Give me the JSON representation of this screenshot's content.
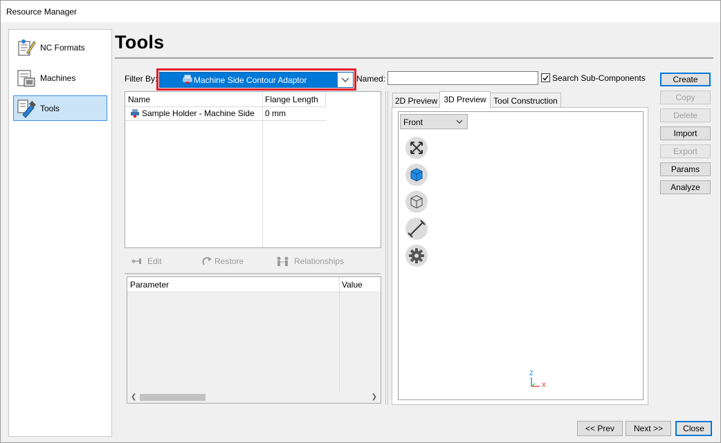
{
  "window": {
    "title": "Resource Manager"
  },
  "nav": {
    "items": [
      {
        "label": "NC Formats",
        "icon": "nc-formats-icon",
        "selected": false
      },
      {
        "label": "Machines",
        "icon": "machines-icon",
        "selected": false
      },
      {
        "label": "Tools",
        "icon": "tools-icon",
        "selected": true
      }
    ]
  },
  "page": {
    "title": "Tools"
  },
  "filter": {
    "label": "Filter By:",
    "selected": "Machine Side Contour Adaptor",
    "icon": "tool-holder-icon"
  },
  "named": {
    "label": "Named:",
    "value": ""
  },
  "search_sub": {
    "label": "Search Sub-Components",
    "checked": true
  },
  "tools_table": {
    "columns": [
      "Name",
      "Flange Length"
    ],
    "rows": [
      {
        "name": "Sample Holder - Machine Side",
        "flange_length": "0 mm"
      }
    ]
  },
  "tool_actions": {
    "edit": "Edit",
    "restore": "Restore",
    "relationships": "Relationships"
  },
  "param_table": {
    "columns": [
      "Parameter",
      "Value"
    ]
  },
  "tabs": [
    {
      "label": "2D Preview",
      "active": false
    },
    {
      "label": "3D Preview",
      "active": true
    },
    {
      "label": "Tool Construction",
      "active": false
    }
  ],
  "preview": {
    "view": "Front",
    "buttons": [
      "fit-view-icon",
      "shaded-cube-icon",
      "wireframe-cube-icon",
      "measure-icon",
      "settings-gear-icon"
    ],
    "axis": {
      "z": "Z",
      "x": "X",
      "z_color": "#0078d7",
      "x_color": "#e0202a"
    }
  },
  "buttons": {
    "create": "Create",
    "copy": "Copy",
    "delete": "Delete",
    "import": "Import",
    "export": "Export",
    "params": "Params",
    "analyze": "Analyze"
  },
  "footer": {
    "prev": "<< Prev",
    "next": "Next >>",
    "close": "Close"
  },
  "colors": {
    "accent": "#0078d7",
    "highlight": "#e0202a",
    "selection": "#cce4f7"
  }
}
